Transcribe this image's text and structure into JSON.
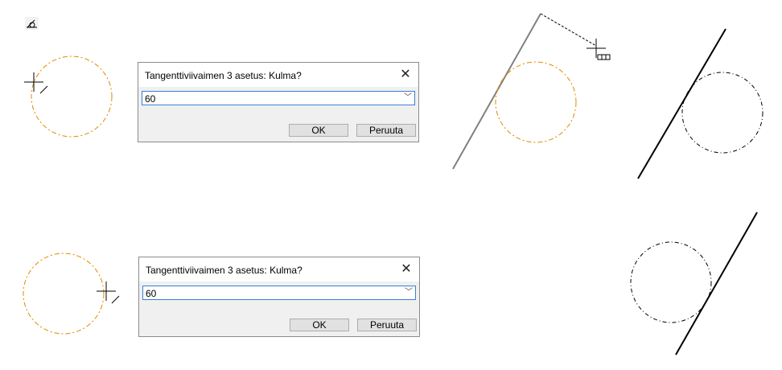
{
  "dialogs": [
    {
      "title": "Tangenttiviivaimen 3 asetus: Kulma?",
      "value": "60",
      "ok_label": "OK",
      "cancel_label": "Peruuta",
      "close_glyph": "✕"
    },
    {
      "title": "Tangenttiviivaimen 3 asetus: Kulma?",
      "value": "60",
      "ok_label": "OK",
      "cancel_label": "Peruuta",
      "close_glyph": "✕"
    }
  ],
  "icons": {
    "tool": "tangent-ruler-tool-icon",
    "crosshair": "crosshair-cursor-icon",
    "ruler_cursor": "ruler-cursor-icon",
    "chevron": "chevron-down-icon"
  },
  "colors": {
    "construction_circle": "#e08a00",
    "circle_black": "#000000",
    "tangent_line": "#000000",
    "ghost_line": "#808080"
  }
}
